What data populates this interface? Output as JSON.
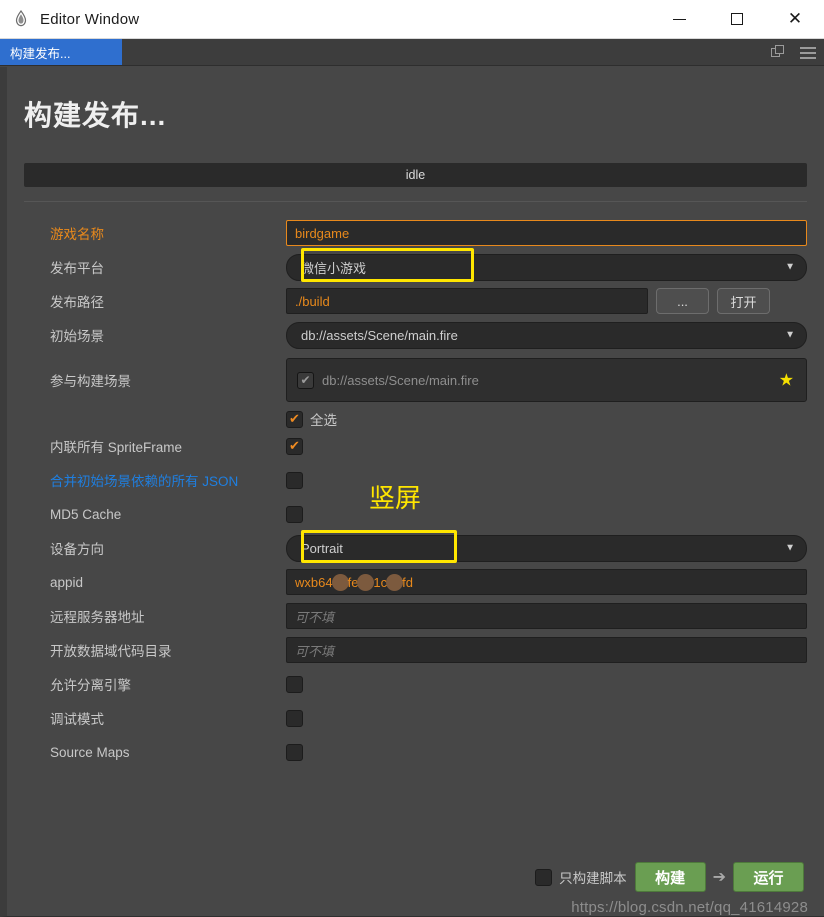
{
  "window": {
    "title": "Editor Window",
    "app_icon": "flame-icon",
    "controls": {
      "minimize": "–",
      "maximize": "□",
      "close": "✕"
    }
  },
  "tabstrip": {
    "active_tab": "构建发布...",
    "icons": [
      "popout-icon",
      "hamburger-menu-icon"
    ]
  },
  "page": {
    "title": "构建发布...",
    "status": "idle"
  },
  "form": {
    "game_name": {
      "label": "游戏名称",
      "value": "birdgame"
    },
    "platform": {
      "label": "发布平台",
      "value": "微信小游戏",
      "caret": "▼"
    },
    "build_path": {
      "label": "发布路径",
      "value": "./build",
      "browse_label": "...",
      "open_label": "打开"
    },
    "start_scene": {
      "label": "初始场景",
      "value": "db://assets/Scene/main.fire",
      "caret": "▼"
    },
    "included_scenes": {
      "label": "参与构建场景",
      "items": [
        {
          "name": "db://assets/Scene/main.fire",
          "checked": true,
          "starred": true
        }
      ],
      "star": "★",
      "select_all_label": "全选"
    },
    "inline_spriteframe": {
      "label": "内联所有 SpriteFrame",
      "checked": true
    },
    "merge_json": {
      "label": "合并初始场景依赖的所有 JSON",
      "checked": false
    },
    "md5_cache": {
      "label": "MD5 Cache",
      "checked": false
    },
    "orientation": {
      "label": "设备方向",
      "value": "Portrait",
      "caret": "▼"
    },
    "appid": {
      "label": "appid",
      "value_prefix": "wxb64",
      "value_mid1": "fe",
      "value_mid2": "1c",
      "value_suffix": "fd"
    },
    "remote_server": {
      "label": "远程服务器地址",
      "placeholder": "可不填",
      "value": ""
    },
    "open_data_dir": {
      "label": "开放数据域代码目录",
      "placeholder": "可不填",
      "value": ""
    },
    "separate_engine": {
      "label": "允许分离引擎",
      "checked": false
    },
    "debug_mode": {
      "label": "调试模式",
      "checked": false
    },
    "source_maps": {
      "label": "Source Maps",
      "checked": false
    }
  },
  "annotations": {
    "orientation_note": "竖屏"
  },
  "footer": {
    "script_only_label": "只构建脚本",
    "build_label": "构建",
    "arrow": "➔",
    "run_label": "运行"
  },
  "watermark": "https://blog.csdn.net/qq_41614928",
  "colors": {
    "accent_orange": "#e8891c",
    "link_blue": "#1f7fe0",
    "annotation_yellow": "#ffe600",
    "button_green": "#6a9e52",
    "tab_blue": "#2f6fcf"
  }
}
